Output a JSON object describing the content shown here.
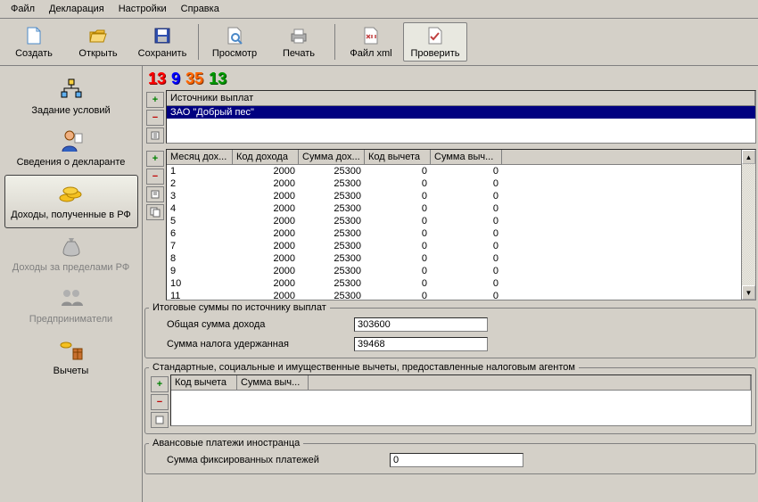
{
  "menu": [
    "Файл",
    "Декларация",
    "Настройки",
    "Справка"
  ],
  "toolbar": [
    {
      "label": "Создать"
    },
    {
      "label": "Открыть"
    },
    {
      "label": "Сохранить"
    },
    {
      "sep": true
    },
    {
      "label": "Просмотр"
    },
    {
      "label": "Печать"
    },
    {
      "sep": true
    },
    {
      "label": "Файл xml"
    },
    {
      "label": "Проверить",
      "hover": true
    }
  ],
  "digits": [
    {
      "v": "13",
      "c": "#ff0000"
    },
    {
      "v": "9",
      "c": "#0000ff"
    },
    {
      "v": "35",
      "c": "#ff6600"
    },
    {
      "v": "13",
      "c": "#009900"
    }
  ],
  "sidebar": [
    {
      "label": "Задание условий"
    },
    {
      "label": "Сведения о декларанте"
    },
    {
      "label": "Доходы, полученные в РФ",
      "selected": true
    },
    {
      "label": "Доходы за пределами РФ",
      "disabled": true
    },
    {
      "label": "Предприниматели",
      "disabled": true
    },
    {
      "label": "Вычеты"
    }
  ],
  "sources": {
    "title": "Источники выплат",
    "rows": [
      "ЗАО \"Добрый пес\""
    ]
  },
  "income": {
    "columns": [
      "Месяц дох...",
      "Код дохода",
      "Сумма дох...",
      "Код вычета",
      "Сумма выч..."
    ],
    "rows": [
      {
        "m": "1",
        "code": "2000",
        "sum": "25300",
        "dcode": "0",
        "dsum": "0"
      },
      {
        "m": "2",
        "code": "2000",
        "sum": "25300",
        "dcode": "0",
        "dsum": "0"
      },
      {
        "m": "3",
        "code": "2000",
        "sum": "25300",
        "dcode": "0",
        "dsum": "0"
      },
      {
        "m": "4",
        "code": "2000",
        "sum": "25300",
        "dcode": "0",
        "dsum": "0"
      },
      {
        "m": "5",
        "code": "2000",
        "sum": "25300",
        "dcode": "0",
        "dsum": "0"
      },
      {
        "m": "6",
        "code": "2000",
        "sum": "25300",
        "dcode": "0",
        "dsum": "0"
      },
      {
        "m": "7",
        "code": "2000",
        "sum": "25300",
        "dcode": "0",
        "dsum": "0"
      },
      {
        "m": "8",
        "code": "2000",
        "sum": "25300",
        "dcode": "0",
        "dsum": "0"
      },
      {
        "m": "9",
        "code": "2000",
        "sum": "25300",
        "dcode": "0",
        "dsum": "0"
      },
      {
        "m": "10",
        "code": "2000",
        "sum": "25300",
        "dcode": "0",
        "dsum": "0"
      },
      {
        "m": "11",
        "code": "2000",
        "sum": "25300",
        "dcode": "0",
        "dsum": "0"
      }
    ]
  },
  "totals": {
    "title": "Итоговые суммы по источнику выплат",
    "total_income_lbl": "Общая сумма дохода",
    "total_income_val": "303600",
    "tax_withheld_lbl": "Сумма налога удержанная",
    "tax_withheld_val": "39468"
  },
  "deductions": {
    "title": "Стандартные, социальные и имущественные вычеты, предоставленные налоговым агентом",
    "columns": [
      "Код вычета",
      "Сумма выч..."
    ]
  },
  "advance": {
    "title": "Авансовые платежи иностранца",
    "fixed_lbl": "Сумма фиксированных платежей",
    "fixed_val": "0"
  }
}
